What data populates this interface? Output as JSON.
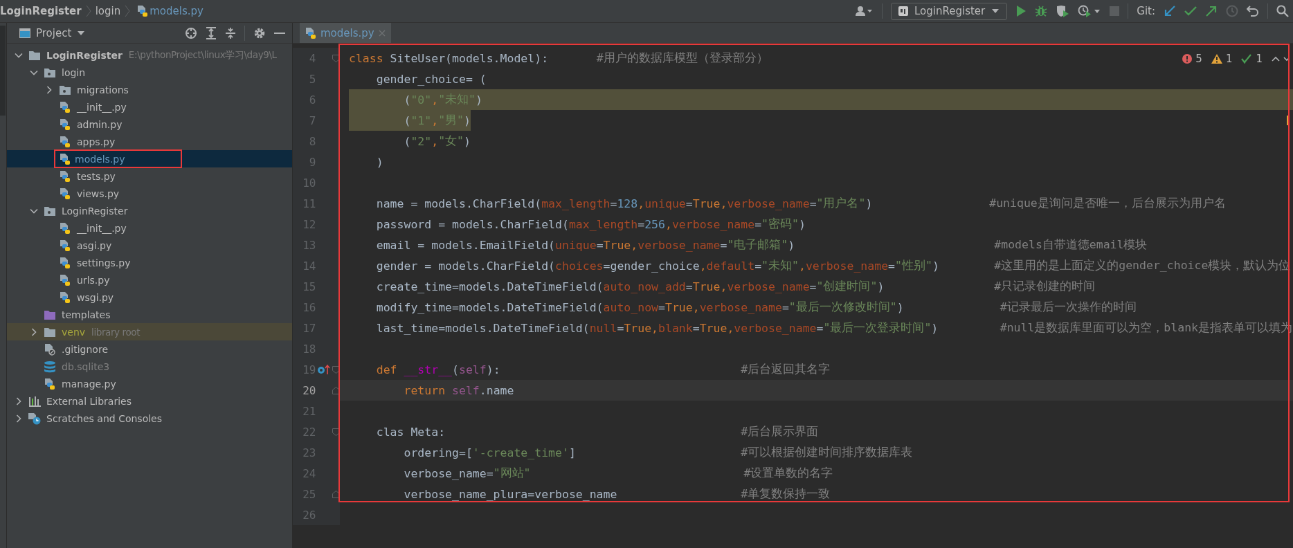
{
  "breadcrumbs": [
    {
      "label": "LoginRegister",
      "kind": "project"
    },
    {
      "label": "login",
      "kind": "folder"
    },
    {
      "label": "models.py",
      "kind": "file"
    }
  ],
  "toolbar": {
    "run_config": "LoginRegister",
    "vcs_label": "Git:"
  },
  "project_panel": {
    "title": "Project"
  },
  "tree": [
    {
      "label": "LoginRegister",
      "note": "E:\\pythonProject\\linux学习\\day9\\L",
      "kind": "project",
      "expanded": true,
      "selected": false,
      "children": [
        {
          "label": "login",
          "kind": "package",
          "expanded": true,
          "selected": false,
          "children": [
            {
              "label": "migrations",
              "kind": "package",
              "expanded": false,
              "selected": false
            },
            {
              "label": "__init__.py",
              "kind": "py",
              "selected": false,
              "modified": false
            },
            {
              "label": "admin.py",
              "kind": "py",
              "selected": false,
              "modified": false
            },
            {
              "label": "apps.py",
              "kind": "py",
              "selected": false,
              "modified": false
            },
            {
              "label": "models.py",
              "kind": "py",
              "selected": true,
              "modified": true
            },
            {
              "label": "tests.py",
              "kind": "py",
              "selected": false,
              "modified": false
            },
            {
              "label": "views.py",
              "kind": "py",
              "selected": false,
              "modified": false
            }
          ]
        },
        {
          "label": "LoginRegister",
          "kind": "package",
          "expanded": true,
          "selected": false,
          "children": [
            {
              "label": "__init__.py",
              "kind": "py",
              "selected": false,
              "modified": false
            },
            {
              "label": "asgi.py",
              "kind": "py",
              "selected": false,
              "modified": false
            },
            {
              "label": "settings.py",
              "kind": "py",
              "selected": false,
              "modified": false
            },
            {
              "label": "urls.py",
              "kind": "py",
              "selected": false,
              "modified": false
            },
            {
              "label": "wsgi.py",
              "kind": "py",
              "selected": false,
              "modified": false
            }
          ]
        },
        {
          "label": "templates",
          "kind": "template_folder",
          "selected": false
        },
        {
          "label": "venv",
          "note": "library root",
          "kind": "library",
          "expanded": false,
          "selected": false
        },
        {
          "label": ".gitignore",
          "kind": "gitignore",
          "selected": false
        },
        {
          "label": "db.sqlite3",
          "kind": "db",
          "selected": false
        },
        {
          "label": "manage.py",
          "kind": "py",
          "selected": false,
          "modified": false
        }
      ]
    },
    {
      "label": "External Libraries",
      "kind": "libs",
      "expanded": false,
      "selected": false
    },
    {
      "label": "Scratches and Consoles",
      "kind": "scratch",
      "expanded": false,
      "selected": false
    }
  ],
  "tab": {
    "label": "models.py",
    "selected": true,
    "modified": true
  },
  "inspections": {
    "errors": "5",
    "warnings": "1",
    "weak_warnings": "1"
  },
  "lines": [
    {
      "number": "4",
      "fold_start": true,
      "fold_end": false,
      "override_marker": false,
      "selected": false,
      "current": false,
      "tokens": [
        {
          "kind": "kw",
          "text": "class"
        },
        {
          "kind": "id",
          "text": " SiteUser(models.Model):"
        },
        {
          "kind": "cmt",
          "text": "       #用户的数据库模型（登录部分）"
        }
      ]
    },
    {
      "number": "5",
      "fold_start": false,
      "fold_end": false,
      "override_marker": false,
      "selected": false,
      "current": false,
      "tokens": [
        {
          "kind": "id",
          "text": "    gender_choice= ("
        }
      ]
    },
    {
      "number": "6",
      "fold_start": false,
      "fold_end": false,
      "override_marker": false,
      "selected": true,
      "current": false,
      "tokens": [
        {
          "kind": "id",
          "text": "        ("
        },
        {
          "kind": "str",
          "text": "\"0\""
        },
        {
          "kind": "kw",
          "text": ","
        },
        {
          "kind": "str",
          "text": "\"未知\""
        },
        {
          "kind": "id",
          "text": ")"
        }
      ]
    },
    {
      "number": "7",
      "fold_start": false,
      "fold_end": false,
      "override_marker": false,
      "selected": true,
      "current": false,
      "tokens": [
        {
          "kind": "id",
          "text": "        ("
        },
        {
          "kind": "str",
          "text": "\"1\""
        },
        {
          "kind": "kw",
          "text": ","
        },
        {
          "kind": "str",
          "text": "\"男\""
        },
        {
          "kind": "id",
          "text": ")"
        }
      ]
    },
    {
      "number": "8",
      "fold_start": false,
      "fold_end": false,
      "override_marker": false,
      "selected": false,
      "current": false,
      "tokens": [
        {
          "kind": "id",
          "text": "        ("
        },
        {
          "kind": "str",
          "text": "\"2\""
        },
        {
          "kind": "kw",
          "text": ","
        },
        {
          "kind": "str",
          "text": "\"女\""
        },
        {
          "kind": "id",
          "text": ")"
        }
      ]
    },
    {
      "number": "9",
      "fold_start": false,
      "fold_end": false,
      "override_marker": false,
      "selected": false,
      "current": false,
      "tokens": [
        {
          "kind": "id",
          "text": "    )"
        }
      ]
    },
    {
      "number": "10",
      "fold_start": false,
      "fold_end": false,
      "override_marker": false,
      "selected": false,
      "current": false
    },
    {
      "number": "11",
      "fold_start": false,
      "fold_end": false,
      "override_marker": false,
      "selected": false,
      "current": false,
      "tokens": [
        {
          "kind": "id",
          "text": "    name = models.CharField("
        },
        {
          "kind": "arg",
          "text": "max_length"
        },
        {
          "kind": "id",
          "text": "="
        },
        {
          "kind": "num",
          "text": "128"
        },
        {
          "kind": "kw",
          "text": ","
        },
        {
          "kind": "arg",
          "text": "unique"
        },
        {
          "kind": "id",
          "text": "="
        },
        {
          "kind": "kw",
          "text": "True,"
        },
        {
          "kind": "arg",
          "text": "verbose_name"
        },
        {
          "kind": "id",
          "text": "="
        },
        {
          "kind": "str",
          "text": "\"用户名\""
        },
        {
          "kind": "id",
          "text": ")"
        },
        {
          "kind": "cmt",
          "text": "                 #unique是询问是否唯一，后台展示为用户名"
        }
      ]
    },
    {
      "number": "12",
      "fold_start": false,
      "fold_end": false,
      "override_marker": false,
      "selected": false,
      "current": false,
      "tokens": [
        {
          "kind": "id",
          "text": "    password = models.CharField("
        },
        {
          "kind": "arg",
          "text": "max_length"
        },
        {
          "kind": "id",
          "text": "="
        },
        {
          "kind": "num",
          "text": "256"
        },
        {
          "kind": "kw",
          "text": ","
        },
        {
          "kind": "arg",
          "text": "verbose_name"
        },
        {
          "kind": "id",
          "text": "="
        },
        {
          "kind": "str",
          "text": "\"密码\""
        },
        {
          "kind": "id",
          "text": ")"
        }
      ]
    },
    {
      "number": "13",
      "fold_start": false,
      "fold_end": false,
      "override_marker": false,
      "selected": false,
      "current": false,
      "tokens": [
        {
          "kind": "id",
          "text": "    email = models.EmailField("
        },
        {
          "kind": "arg",
          "text": "unique"
        },
        {
          "kind": "id",
          "text": "="
        },
        {
          "kind": "kw",
          "text": "True,"
        },
        {
          "kind": "arg",
          "text": "verbose_name"
        },
        {
          "kind": "id",
          "text": "="
        },
        {
          "kind": "str",
          "text": "\"电子邮箱\""
        },
        {
          "kind": "id",
          "text": ")"
        },
        {
          "kind": "cmt",
          "text": "                             #models自带道德email模块"
        }
      ]
    },
    {
      "number": "14",
      "fold_start": false,
      "fold_end": false,
      "override_marker": false,
      "selected": false,
      "current": false,
      "tokens": [
        {
          "kind": "id",
          "text": "    gender = models.CharField("
        },
        {
          "kind": "arg",
          "text": "choices"
        },
        {
          "kind": "id",
          "text": "=gender_choice"
        },
        {
          "kind": "kw",
          "text": ","
        },
        {
          "kind": "arg",
          "text": "default"
        },
        {
          "kind": "id",
          "text": "="
        },
        {
          "kind": "str",
          "text": "\"未知\""
        },
        {
          "kind": "kw",
          "text": ","
        },
        {
          "kind": "arg",
          "text": "verbose_name"
        },
        {
          "kind": "id",
          "text": "="
        },
        {
          "kind": "str",
          "text": "\"性别\""
        },
        {
          "kind": "id",
          "text": ")"
        },
        {
          "kind": "cmt",
          "text": "        #这里用的是上面定义的gender_choice模块，默认为位"
        }
      ]
    },
    {
      "number": "15",
      "fold_start": false,
      "fold_end": false,
      "override_marker": false,
      "selected": false,
      "current": false,
      "tokens": [
        {
          "kind": "id",
          "text": "    create_time=models.DateTimeField("
        },
        {
          "kind": "arg",
          "text": "auto_now_add"
        },
        {
          "kind": "id",
          "text": "="
        },
        {
          "kind": "kw",
          "text": "True,"
        },
        {
          "kind": "arg",
          "text": "verbose_name"
        },
        {
          "kind": "id",
          "text": "="
        },
        {
          "kind": "str",
          "text": "\"创建时间\""
        },
        {
          "kind": "id",
          "text": ")"
        },
        {
          "kind": "cmt",
          "text": "                #只记录创建的时间"
        }
      ]
    },
    {
      "number": "16",
      "fold_start": false,
      "fold_end": false,
      "override_marker": false,
      "selected": false,
      "current": false,
      "tokens": [
        {
          "kind": "id",
          "text": "    modify_time=models.DateTimeField("
        },
        {
          "kind": "arg",
          "text": "auto_now"
        },
        {
          "kind": "id",
          "text": "="
        },
        {
          "kind": "kw",
          "text": "True,"
        },
        {
          "kind": "arg",
          "text": "verbose_name"
        },
        {
          "kind": "id",
          "text": "="
        },
        {
          "kind": "str",
          "text": "\"最后一次修改时间\""
        },
        {
          "kind": "id",
          "text": ")"
        },
        {
          "kind": "cmt",
          "text": "              #记录最后一次操作的时间"
        }
      ]
    },
    {
      "number": "17",
      "fold_start": false,
      "fold_end": false,
      "override_marker": false,
      "selected": false,
      "current": false,
      "tokens": [
        {
          "kind": "id",
          "text": "    last_time=models.DateTimeField("
        },
        {
          "kind": "arg",
          "text": "null"
        },
        {
          "kind": "id",
          "text": "="
        },
        {
          "kind": "kw",
          "text": "True,"
        },
        {
          "kind": "arg",
          "text": "blank"
        },
        {
          "kind": "id",
          "text": "="
        },
        {
          "kind": "kw",
          "text": "True,"
        },
        {
          "kind": "arg",
          "text": "verbose_name"
        },
        {
          "kind": "id",
          "text": "="
        },
        {
          "kind": "str",
          "text": "\"最后一次登录时间\""
        },
        {
          "kind": "id",
          "text": ")"
        },
        {
          "kind": "cmt",
          "text": "         #null是数据库里面可以为空，blank是指表单可以填为"
        }
      ]
    },
    {
      "number": "18",
      "fold_start": false,
      "fold_end": false,
      "override_marker": false,
      "selected": false,
      "current": false
    },
    {
      "number": "19",
      "fold_start": true,
      "fold_end": false,
      "override_marker": true,
      "selected": false,
      "current": false,
      "tokens": [
        {
          "kind": "kw",
          "text": "    def "
        },
        {
          "kind": "magic",
          "text": "__str__"
        },
        {
          "kind": "id",
          "text": "("
        },
        {
          "kind": "self",
          "text": "self"
        },
        {
          "kind": "id",
          "text": "):"
        },
        {
          "kind": "cmt",
          "text": "                                   #后台返回其名字"
        }
      ]
    },
    {
      "number": "20",
      "fold_start": false,
      "fold_end": true,
      "override_marker": false,
      "selected": false,
      "current": true,
      "tokens": [
        {
          "kind": "kw",
          "text": "        return "
        },
        {
          "kind": "self",
          "text": "self"
        },
        {
          "kind": "id",
          "text": ".name"
        }
      ]
    },
    {
      "number": "21",
      "fold_start": false,
      "fold_end": false,
      "override_marker": false,
      "selected": false,
      "current": false
    },
    {
      "number": "22",
      "fold_start": true,
      "fold_end": false,
      "override_marker": false,
      "selected": false,
      "current": false,
      "tokens": [
        {
          "kind": "id",
          "text": "    clas Meta:"
        },
        {
          "kind": "cmt",
          "text": "                                           #后台展示界面"
        }
      ]
    },
    {
      "number": "23",
      "fold_start": false,
      "fold_end": false,
      "override_marker": false,
      "selected": false,
      "current": false,
      "tokens": [
        {
          "kind": "id",
          "text": "        ordering=["
        },
        {
          "kind": "str",
          "text": "'-create_time'"
        },
        {
          "kind": "id",
          "text": "]"
        },
        {
          "kind": "cmt",
          "text": "                        #可以根据创建时间排序数据库表"
        }
      ]
    },
    {
      "number": "24",
      "fold_start": false,
      "fold_end": false,
      "override_marker": false,
      "selected": false,
      "current": false,
      "tokens": [
        {
          "kind": "id",
          "text": "        verbose_name="
        },
        {
          "kind": "str",
          "text": "\"网站\""
        },
        {
          "kind": "cmt",
          "text": "                               #设置单数的名字"
        }
      ]
    },
    {
      "number": "25",
      "fold_start": false,
      "fold_end": true,
      "override_marker": false,
      "selected": false,
      "current": false,
      "tokens": [
        {
          "kind": "id",
          "text": "        verbose_name_plura=verbose_name"
        },
        {
          "kind": "cmt",
          "text": "                  #单复数保持一致"
        }
      ]
    },
    {
      "number": "26",
      "fold_start": false,
      "fold_end": false,
      "override_marker": false,
      "selected": false,
      "current": false
    }
  ]
}
